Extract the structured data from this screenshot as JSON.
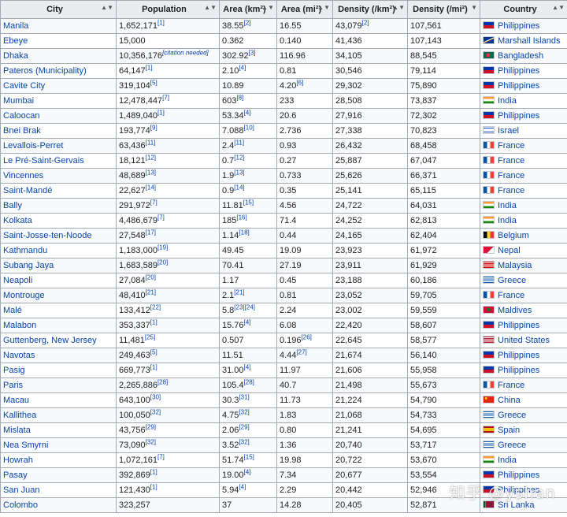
{
  "headers": [
    {
      "label": "City",
      "sort": "▲▼"
    },
    {
      "label": "Population",
      "sort": "▲▼"
    },
    {
      "label": "Area (km²)",
      "sort": "▲▼"
    },
    {
      "label": "Area (mi²)",
      "sort": "▲▼"
    },
    {
      "label": "Density (/km²)",
      "sort": "▲▼"
    },
    {
      "label": "Density (/mi²)",
      "sort": "▼"
    },
    {
      "label": "Country",
      "sort": "▲▼"
    }
  ],
  "rows": [
    {
      "city": "Manila",
      "pop": "1,652,171",
      "pop_ref": "[1]",
      "area_km": "38.55",
      "area_km_ref": "[2]",
      "area_mi": "16.55",
      "area_mi_ref": "",
      "den_km": "43,079",
      "den_km_ref": "[2]",
      "den_mi": "107,561",
      "country": "Philippines",
      "flag": "ph"
    },
    {
      "city": "Ebeye",
      "pop": "15,000",
      "pop_ref": "",
      "area_km": "0.362",
      "area_km_ref": "",
      "area_mi": "0.140",
      "area_mi_ref": "",
      "den_km": "41,436",
      "den_km_ref": "",
      "den_mi": "107,143",
      "country": "Marshall Islands",
      "flag": "mh"
    },
    {
      "city": "Dhaka",
      "pop": "10,356,176",
      "pop_ref": "[citation needed]",
      "area_km": "302.92",
      "area_km_ref": "[3]",
      "area_mi": "116.96",
      "area_mi_ref": "",
      "den_km": "34,105",
      "den_km_ref": "",
      "den_mi": "88,545",
      "country": "Bangladesh",
      "flag": "bd"
    },
    {
      "city": "Pateros (Municipality)",
      "pop": "64,147",
      "pop_ref": "[1]",
      "area_km": "2.10",
      "area_km_ref": "[4]",
      "area_mi": "0.81",
      "area_mi_ref": "",
      "den_km": "30,546",
      "den_km_ref": "",
      "den_mi": "79,114",
      "country": "Philippines",
      "flag": "ph"
    },
    {
      "city": "Cavite City",
      "pop": "319,104",
      "pop_ref": "[5]",
      "area_km": "10.89",
      "area_km_ref": "",
      "area_mi": "4.20",
      "area_mi_ref": "[6]",
      "den_km": "29,302",
      "den_km_ref": "",
      "den_mi": "75,890",
      "country": "Philippines",
      "flag": "ph"
    },
    {
      "city": "Mumbai",
      "pop": "12,478,447",
      "pop_ref": "[7]",
      "area_km": "603",
      "area_km_ref": "[8]",
      "area_mi": "233",
      "area_mi_ref": "",
      "den_km": "28,508",
      "den_km_ref": "",
      "den_mi": "73,837",
      "country": "India",
      "flag": "in"
    },
    {
      "city": "Caloocan",
      "pop": "1,489,040",
      "pop_ref": "[1]",
      "area_km": "53.34",
      "area_km_ref": "[4]",
      "area_mi": "20.6",
      "area_mi_ref": "",
      "den_km": "27,916",
      "den_km_ref": "",
      "den_mi": "72,302",
      "country": "Philippines",
      "flag": "ph"
    },
    {
      "city": "Bnei Brak",
      "pop": "193,774",
      "pop_ref": "[9]",
      "area_km": "7.088",
      "area_km_ref": "[10]",
      "area_mi": "2.736",
      "area_mi_ref": "",
      "den_km": "27,338",
      "den_km_ref": "",
      "den_mi": "70,823",
      "country": "Israel",
      "flag": "il"
    },
    {
      "city": "Levallois-Perret",
      "pop": "63,436",
      "pop_ref": "[11]",
      "area_km": "2.4",
      "area_km_ref": "[11]",
      "area_mi": "0.93",
      "area_mi_ref": "",
      "den_km": "26,432",
      "den_km_ref": "",
      "den_mi": "68,458",
      "country": "France",
      "flag": "fr"
    },
    {
      "city": "Le Pré-Saint-Gervais",
      "pop": "18,121",
      "pop_ref": "[12]",
      "area_km": "0.7",
      "area_km_ref": "[12]",
      "area_mi": "0.27",
      "area_mi_ref": "",
      "den_km": "25,887",
      "den_km_ref": "",
      "den_mi": "67,047",
      "country": "France",
      "flag": "fr"
    },
    {
      "city": "Vincennes",
      "pop": "48,689",
      "pop_ref": "[13]",
      "area_km": "1.9",
      "area_km_ref": "[13]",
      "area_mi": "0.733",
      "area_mi_ref": "",
      "den_km": "25,626",
      "den_km_ref": "",
      "den_mi": "66,371",
      "country": "France",
      "flag": "fr"
    },
    {
      "city": "Saint-Mandé",
      "pop": "22,627",
      "pop_ref": "[14]",
      "area_km": "0.9",
      "area_km_ref": "[14]",
      "area_mi": "0.35",
      "area_mi_ref": "",
      "den_km": "25,141",
      "den_km_ref": "",
      "den_mi": "65,115",
      "country": "France",
      "flag": "fr"
    },
    {
      "city": "Bally",
      "pop": "291,972",
      "pop_ref": "[7]",
      "area_km": "11.81",
      "area_km_ref": "[15]",
      "area_mi": "4.56",
      "area_mi_ref": "",
      "den_km": "24,722",
      "den_km_ref": "",
      "den_mi": "64,031",
      "country": "India",
      "flag": "in"
    },
    {
      "city": "Kolkata",
      "pop": "4,486,679",
      "pop_ref": "[7]",
      "area_km": "185",
      "area_km_ref": "[16]",
      "area_mi": "71.4",
      "area_mi_ref": "",
      "den_km": "24,252",
      "den_km_ref": "",
      "den_mi": "62,813",
      "country": "India",
      "flag": "in"
    },
    {
      "city": "Saint-Josse-ten-Noode",
      "pop": "27,548",
      "pop_ref": "[17]",
      "area_km": "1.14",
      "area_km_ref": "[18]",
      "area_mi": "0.44",
      "area_mi_ref": "",
      "den_km": "24,165",
      "den_km_ref": "",
      "den_mi": "62,404",
      "country": "Belgium",
      "flag": "be"
    },
    {
      "city": "Kathmandu",
      "pop": "1,183,000",
      "pop_ref": "[19]",
      "area_km": "49.45",
      "area_km_ref": "",
      "area_mi": "19.09",
      "area_mi_ref": "",
      "den_km": "23,923",
      "den_km_ref": "",
      "den_mi": "61,972",
      "country": "Nepal",
      "flag": "np"
    },
    {
      "city": "Subang Jaya",
      "pop": "1,683,589",
      "pop_ref": "[20]",
      "area_km": "70.41",
      "area_km_ref": "",
      "area_mi": "27.19",
      "area_mi_ref": "",
      "den_km": "23,911",
      "den_km_ref": "",
      "den_mi": "61,929",
      "country": "Malaysia",
      "flag": "my"
    },
    {
      "city": "Neapoli",
      "pop": "27,084",
      "pop_ref": "[20]",
      "area_km": "1.17",
      "area_km_ref": "",
      "area_mi": "0.45",
      "area_mi_ref": "",
      "den_km": "23,188",
      "den_km_ref": "",
      "den_mi": "60,186",
      "country": "Greece",
      "flag": "gr"
    },
    {
      "city": "Montrouge",
      "pop": "48,410",
      "pop_ref": "[21]",
      "area_km": "2.1",
      "area_km_ref": "[21]",
      "area_mi": "0.81",
      "area_mi_ref": "",
      "den_km": "23,052",
      "den_km_ref": "",
      "den_mi": "59,705",
      "country": "France",
      "flag": "fr"
    },
    {
      "city": "Malé",
      "pop": "133,412",
      "pop_ref": "[22]",
      "area_km": "5.8",
      "area_km_ref": "[23][24]",
      "area_mi": "2.24",
      "area_mi_ref": "",
      "den_km": "23,002",
      "den_km_ref": "",
      "den_mi": "59,559",
      "country": "Maldives",
      "flag": "mv"
    },
    {
      "city": "Malabon",
      "pop": "353,337",
      "pop_ref": "[1]",
      "area_km": "15.76",
      "area_km_ref": "[4]",
      "area_mi": "6.08",
      "area_mi_ref": "",
      "den_km": "22,420",
      "den_km_ref": "",
      "den_mi": "58,607",
      "country": "Philippines",
      "flag": "ph"
    },
    {
      "city": "Guttenberg, New Jersey",
      "pop": "11,481",
      "pop_ref": "[25]",
      "area_km": "0.507",
      "area_km_ref": "",
      "area_mi": "0.196",
      "area_mi_ref": "[26]",
      "den_km": "22,645",
      "den_km_ref": "",
      "den_mi": "58,577",
      "country": "United States",
      "flag": "us"
    },
    {
      "city": "Navotas",
      "pop": "249,463",
      "pop_ref": "[5]",
      "area_km": "11.51",
      "area_km_ref": "",
      "area_mi": "4.44",
      "area_mi_ref": "[27]",
      "den_km": "21,674",
      "den_km_ref": "",
      "den_mi": "56,140",
      "country": "Philippines",
      "flag": "ph"
    },
    {
      "city": "Pasig",
      "pop": "669,773",
      "pop_ref": "[1]",
      "area_km": "31.00",
      "area_km_ref": "[4]",
      "area_mi": "11.97",
      "area_mi_ref": "",
      "den_km": "21,606",
      "den_km_ref": "",
      "den_mi": "55,958",
      "country": "Philippines",
      "flag": "ph"
    },
    {
      "city": "Paris",
      "pop": "2,265,886",
      "pop_ref": "[28]",
      "area_km": "105.4",
      "area_km_ref": "[28]",
      "area_mi": "40.7",
      "area_mi_ref": "",
      "den_km": "21,498",
      "den_km_ref": "",
      "den_mi": "55,673",
      "country": "France",
      "flag": "fr"
    },
    {
      "city": "Macau",
      "pop": "643,100",
      "pop_ref": "[30]",
      "area_km": "30.3",
      "area_km_ref": "[31]",
      "area_mi": "11.73",
      "area_mi_ref": "",
      "den_km": "21,224",
      "den_km_ref": "",
      "den_mi": "54,790",
      "country": "China",
      "flag": "cn"
    },
    {
      "city": "Kallithea",
      "pop": "100,050",
      "pop_ref": "[32]",
      "area_km": "4.75",
      "area_km_ref": "[32]",
      "area_mi": "1.83",
      "area_mi_ref": "",
      "den_km": "21,068",
      "den_km_ref": "",
      "den_mi": "54,733",
      "country": "Greece",
      "flag": "gr"
    },
    {
      "city": "Mislata",
      "pop": "43,756",
      "pop_ref": "[29]",
      "area_km": "2.06",
      "area_km_ref": "[29]",
      "area_mi": "0.80",
      "area_mi_ref": "",
      "den_km": "21,241",
      "den_km_ref": "",
      "den_mi": "54,695",
      "country": "Spain",
      "flag": "es"
    },
    {
      "city": "Nea Smyrni",
      "pop": "73,090",
      "pop_ref": "[32]",
      "area_km": "3.52",
      "area_km_ref": "[32]",
      "area_mi": "1.36",
      "area_mi_ref": "",
      "den_km": "20,740",
      "den_km_ref": "",
      "den_mi": "53,717",
      "country": "Greece",
      "flag": "gr"
    },
    {
      "city": "Howrah",
      "pop": "1,072,161",
      "pop_ref": "[7]",
      "area_km": "51.74",
      "area_km_ref": "[15]",
      "area_mi": "19.98",
      "area_mi_ref": "",
      "den_km": "20,722",
      "den_km_ref": "",
      "den_mi": "53,670",
      "country": "India",
      "flag": "in"
    },
    {
      "city": "Pasay",
      "pop": "392,869",
      "pop_ref": "[1]",
      "area_km": "19.00",
      "area_km_ref": "[4]",
      "area_mi": "7.34",
      "area_mi_ref": "",
      "den_km": "20,677",
      "den_km_ref": "",
      "den_mi": "53,554",
      "country": "Philippines",
      "flag": "ph"
    },
    {
      "city": "San Juan",
      "pop": "121,430",
      "pop_ref": "[1]",
      "area_km": "5.94",
      "area_km_ref": "[4]",
      "area_mi": "2.29",
      "area_mi_ref": "",
      "den_km": "20,442",
      "den_km_ref": "",
      "den_mi": "52,946",
      "country": "Philippines",
      "flag": "ph"
    },
    {
      "city": "Colombo",
      "pop": "323,257",
      "pop_ref": "",
      "area_km": "37",
      "area_km_ref": "",
      "area_mi": "14.28",
      "area_mi_ref": "",
      "den_km": "20,405",
      "den_km_ref": "",
      "den_mi": "52,871",
      "country": "Sri Lanka",
      "flag": "lk"
    }
  ],
  "flag_styles": {
    "ph": "linear-gradient(to bottom,#0038a8 50%,#ce1126 50%)",
    "mh": "linear-gradient(155deg,#003893 45%,#ffffff 46%,#ffffff 52%,#dd7500 53%,#dd7500 58%,#003893 59%)",
    "bd": "radial-gradient(circle at 45% 50%,#f42a41 30%,#006a4e 32%)",
    "in": "linear-gradient(to bottom,#ff9933 33%,#ffffff 33%,#ffffff 66%,#138808 66%)",
    "il": "linear-gradient(to bottom,#ffffff 15%,#0038b8 15%,#0038b8 27%,#ffffff 27%,#ffffff 73%,#0038b8 73%,#0038b8 85%,#ffffff 85%)",
    "fr": "linear-gradient(to right,#0055a4 33%,#ffffff 33%,#ffffff 66%,#ef4135 66%)",
    "be": "linear-gradient(to right,#000000 33%,#fdda24 33%,#fdda24 66%,#ef3340 66%)",
    "np": "linear-gradient(135deg,#dc143c 60%,#ffffff 60%)",
    "my": "linear-gradient(to bottom,#cc0001 14%,#ffffff 14%,#ffffff 28%,#cc0001 28%,#cc0001 42%,#ffffff 42%,#ffffff 56%,#cc0001 56%,#cc0001 70%,#ffffff 70%,#ffffff 84%,#cc0001 84%)",
    "gr": "linear-gradient(to bottom,#0d5eaf 11%,#ffffff 11%,#ffffff 22%,#0d5eaf 22%,#0d5eaf 33%,#ffffff 33%,#ffffff 44%,#0d5eaf 44%,#0d5eaf 55%,#ffffff 55%,#ffffff 66%,#0d5eaf 66%,#0d5eaf 77%,#ffffff 77%,#ffffff 88%,#0d5eaf 88%)",
    "mv": "radial-gradient(circle at 50% 50%,#007e3a 28%,#d21034 30%)",
    "us": "linear-gradient(to bottom,#b22234 14%,#ffffff 14%,#ffffff 28%,#b22234 28%,#b22234 42%,#ffffff 42%,#ffffff 56%,#b22234 56%,#b22234 70%,#ffffff 70%,#ffffff 84%,#b22234 84%)",
    "cn": "radial-gradient(circle at 25% 30%,#ffde00 12%,#de2910 14%)",
    "es": "linear-gradient(to bottom,#aa151b 25%,#f1bf00 25%,#f1bf00 75%,#aa151b 75%)",
    "lk": "linear-gradient(to right,#00534e 18%,#f7b718 18%,#f7b718 24%,#8d153a 24%)"
  },
  "watermark": "知乎 @yshan"
}
